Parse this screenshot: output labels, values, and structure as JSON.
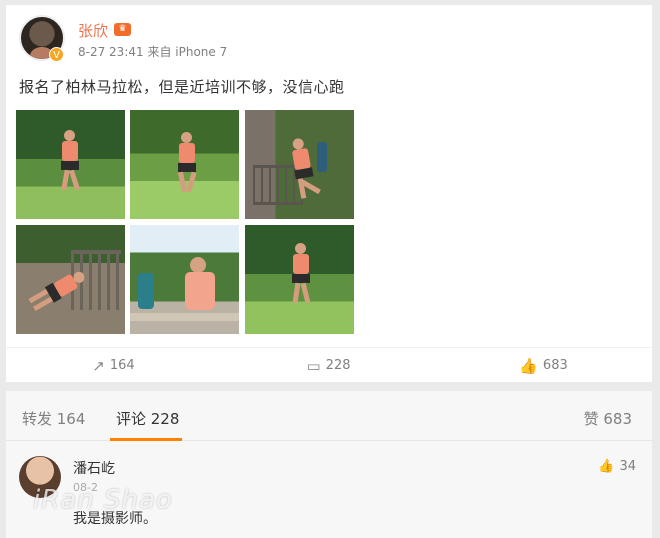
{
  "post": {
    "username": "张欣",
    "timestamp": "8-27 23:41",
    "source": "来自 iPhone 7",
    "text": "报名了柏林马拉松，但是近培训不够，没信心跑",
    "photos": [
      {
        "name": "photo-1",
        "scene": "runner-park"
      },
      {
        "name": "photo-2",
        "scene": "runner-park"
      },
      {
        "name": "photo-3",
        "scene": "stretching-railing"
      },
      {
        "name": "photo-4",
        "scene": "stretching-railing"
      },
      {
        "name": "photo-5",
        "scene": "resting-bench"
      },
      {
        "name": "photo-6",
        "scene": "runner-park"
      }
    ],
    "actions": {
      "repost_count": "164",
      "comment_count": "228",
      "like_count": "683"
    }
  },
  "tabs": {
    "repost": "转发 164",
    "comment": "评论 228",
    "like": "赞 683"
  },
  "comment": {
    "username": "潘石屹",
    "time": "08-2",
    "text": "我是摄影师。",
    "like_count": "34"
  },
  "watermark": "iRan Shao",
  "colors": {
    "username": "#eb7350",
    "active_tab_underline": "#ff8200",
    "vip_badge": "#f6a623"
  },
  "icons": [
    "verified-badge-icon",
    "member-crown-icon",
    "repost-icon",
    "comment-icon",
    "like-icon"
  ]
}
